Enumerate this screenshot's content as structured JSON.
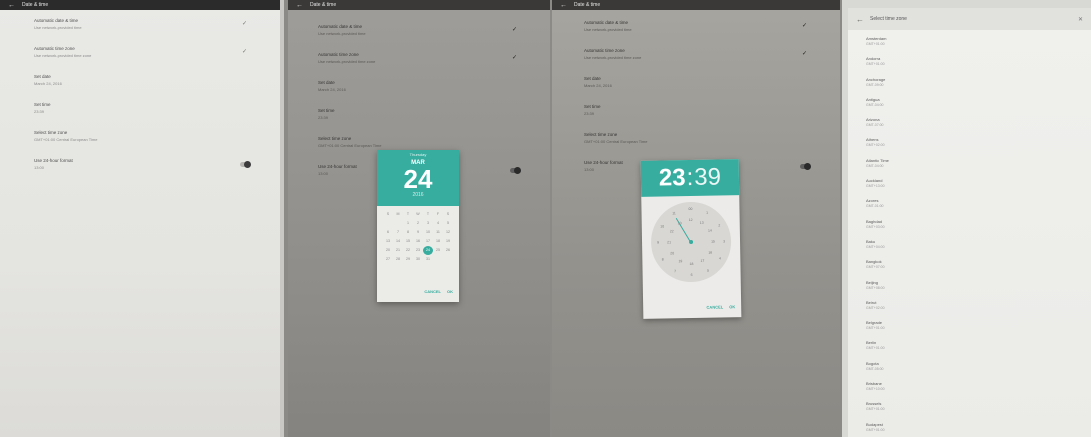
{
  "settings": {
    "title": "Date & time",
    "rows": [
      {
        "title": "Automatic date & time",
        "subtitle": "Use network-provided time"
      },
      {
        "title": "Automatic time zone",
        "subtitle": "Use network-provided time zone"
      },
      {
        "title": "Set date",
        "subtitle": "March 24, 2016"
      },
      {
        "title": "Set time",
        "subtitle": "23:39"
      },
      {
        "title": "Select time zone",
        "subtitle": "GMT+01:00 Central European Time"
      },
      {
        "title": "Use 24-hour format",
        "subtitle": "13:00"
      }
    ]
  },
  "date_picker": {
    "weekday": "Thursday",
    "month": "MAR",
    "day": "24",
    "year": "2016",
    "weekday_initials": [
      "S",
      "M",
      "T",
      "W",
      "T",
      "F",
      "S"
    ],
    "weeks": [
      [
        "",
        "",
        "1",
        "2",
        "3",
        "4",
        "5"
      ],
      [
        "6",
        "7",
        "8",
        "9",
        "10",
        "11",
        "12"
      ],
      [
        "13",
        "14",
        "15",
        "16",
        "17",
        "18",
        "19"
      ],
      [
        "20",
        "21",
        "22",
        "23",
        "24",
        "25",
        "26"
      ],
      [
        "27",
        "28",
        "29",
        "30",
        "31",
        "",
        ""
      ]
    ],
    "selected_day": "24",
    "cancel_label": "CANCEL",
    "ok_label": "OK"
  },
  "time_picker": {
    "hour": "23",
    "minute": "39",
    "dial_numbers": [
      "00",
      "1",
      "2",
      "3",
      "4",
      "5",
      "6",
      "7",
      "8",
      "9",
      "10",
      "11",
      "12",
      "13",
      "14",
      "15",
      "16",
      "17",
      "18",
      "19",
      "20",
      "21",
      "22",
      "23"
    ],
    "cancel_label": "CANCEL",
    "ok_label": "OK"
  },
  "timezone_picker": {
    "title": "Select time zone",
    "items": [
      {
        "name": "Amsterdam",
        "offset": "GMT+01:00"
      },
      {
        "name": "Andorra",
        "offset": "GMT+01:00"
      },
      {
        "name": "Anchorage",
        "offset": "GMT-09:00"
      },
      {
        "name": "Antigua",
        "offset": "GMT-04:00"
      },
      {
        "name": "Arizona",
        "offset": "GMT-07:00"
      },
      {
        "name": "Athens",
        "offset": "GMT+02:00"
      },
      {
        "name": "Atlantic Time",
        "offset": "GMT-04:00"
      },
      {
        "name": "Auckland",
        "offset": "GMT+13:00"
      },
      {
        "name": "Azores",
        "offset": "GMT-01:00"
      },
      {
        "name": "Baghdad",
        "offset": "GMT+03:00"
      },
      {
        "name": "Baku",
        "offset": "GMT+04:00"
      },
      {
        "name": "Bangkok",
        "offset": "GMT+07:00"
      },
      {
        "name": "Beijing",
        "offset": "GMT+08:00"
      },
      {
        "name": "Beirut",
        "offset": "GMT+02:00"
      },
      {
        "name": "Belgrade",
        "offset": "GMT+01:00"
      },
      {
        "name": "Berlin",
        "offset": "GMT+01:00"
      },
      {
        "name": "Bogota",
        "offset": "GMT-05:00"
      },
      {
        "name": "Brisbane",
        "offset": "GMT+10:00"
      },
      {
        "name": "Brussels",
        "offset": "GMT+01:00"
      },
      {
        "name": "Budapest",
        "offset": "GMT+01:00"
      }
    ]
  },
  "colors": {
    "accent": "#36ad9f",
    "appbar_dark": "#2b2b2b"
  },
  "icons": {
    "back": "arrow-back-icon",
    "check": "check-icon",
    "close": "close-icon"
  }
}
